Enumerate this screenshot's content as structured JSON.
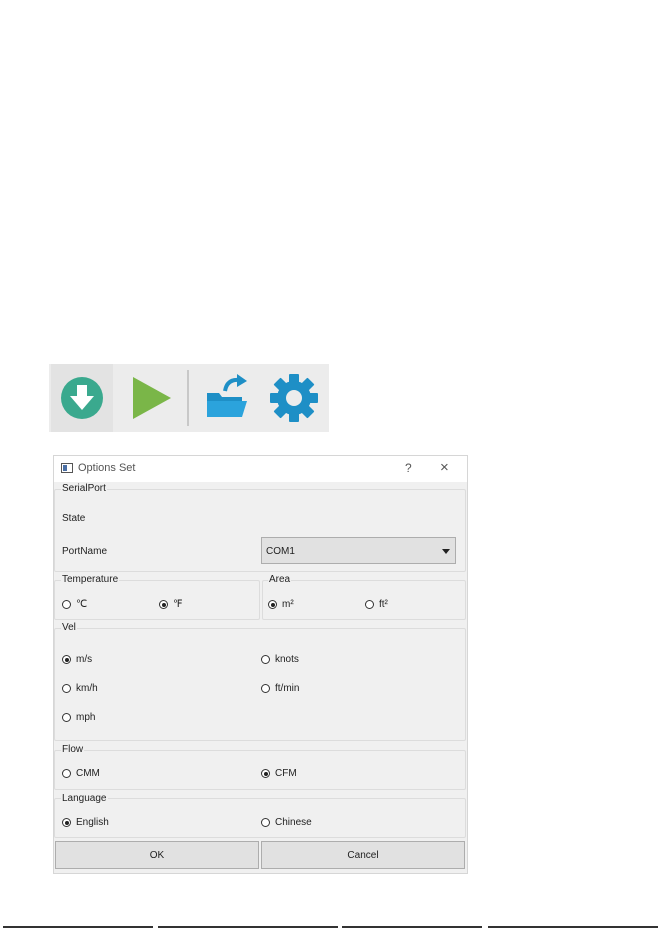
{
  "toolbar": {
    "buttons": [
      {
        "icon": "download-circle-icon",
        "color": "#3aa98e"
      },
      {
        "icon": "play-icon",
        "color": "#7ab648"
      },
      {
        "icon": "open-folder-export-icon",
        "color": "#1e8fc6"
      },
      {
        "icon": "gear-icon",
        "color": "#1e8fc6"
      }
    ]
  },
  "dialog": {
    "title": "Options Set",
    "help": "?",
    "close": "×",
    "serial": {
      "title": "SerialPort",
      "state_label": "State",
      "portname_label": "PortName",
      "portname_value": "COM1"
    },
    "temperature": {
      "title": "Temperature",
      "options": [
        {
          "label": "℃",
          "checked": false
        },
        {
          "label": "℉",
          "checked": true
        }
      ]
    },
    "area": {
      "title": "Area",
      "options": [
        {
          "label": "m²",
          "checked": true
        },
        {
          "label": "ft²",
          "checked": false
        }
      ]
    },
    "vel": {
      "title": "Vel",
      "options": [
        {
          "label": "m/s",
          "checked": true
        },
        {
          "label": "knots",
          "checked": false
        },
        {
          "label": "km/h",
          "checked": false
        },
        {
          "label": "ft/min",
          "checked": false
        },
        {
          "label": "mph",
          "checked": false
        }
      ]
    },
    "flow": {
      "title": "Flow",
      "options": [
        {
          "label": "CMM",
          "checked": false
        },
        {
          "label": "CFM",
          "checked": true
        }
      ]
    },
    "language": {
      "title": "Language",
      "options": [
        {
          "label": "English",
          "checked": true
        },
        {
          "label": "Chinese",
          "checked": false
        }
      ]
    },
    "ok_label": "OK",
    "cancel_label": "Cancel"
  }
}
